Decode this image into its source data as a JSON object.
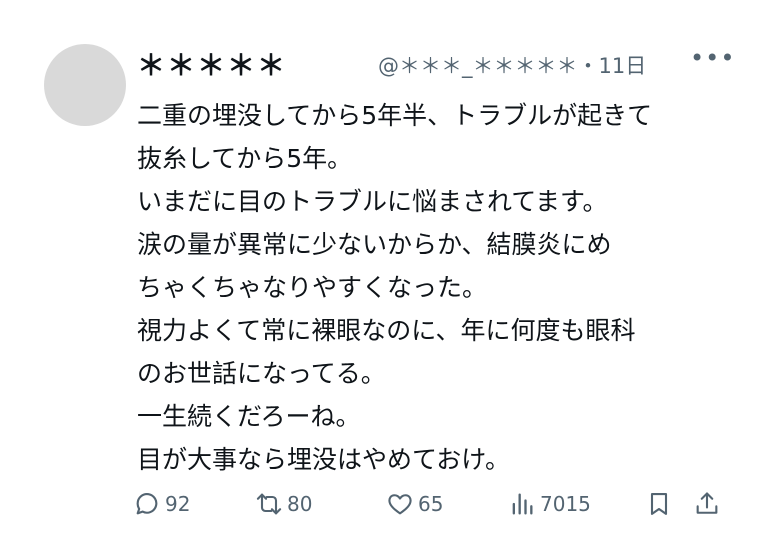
{
  "tweet": {
    "display_name": "＊＊＊＊＊",
    "meta": "@＊＊＊_＊＊＊＊＊・11日",
    "lines": [
      "二重の埋没してから5年半、トラブルが起きて",
      "抜糸してから5年。",
      " いまだに目のトラブルに悩まされてます。",
      " 涙の量が異常に少ないからか、結膜炎にめ",
      "ちゃくちゃなりやすくなった。",
      " 視力よくて常に裸眼なのに、年に何度も眼科",
      "のお世話になってる。",
      " 一生続くだろーね。",
      " 目が大事なら埋没はやめておけ。"
    ]
  },
  "actions": {
    "reply_count": "92",
    "retweet_count": "80",
    "like_count": "65",
    "views_count": "7015"
  },
  "icons": {
    "avatar": "avatar-placeholder",
    "more": "more-icon",
    "reply": "reply-icon",
    "retweet": "retweet-icon",
    "like": "heart-icon",
    "views": "views-icon",
    "bookmark": "bookmark-icon",
    "share": "share-icon"
  },
  "colors": {
    "text": "#0f1419",
    "muted": "#536471",
    "avatar": "#d9d9d9"
  }
}
